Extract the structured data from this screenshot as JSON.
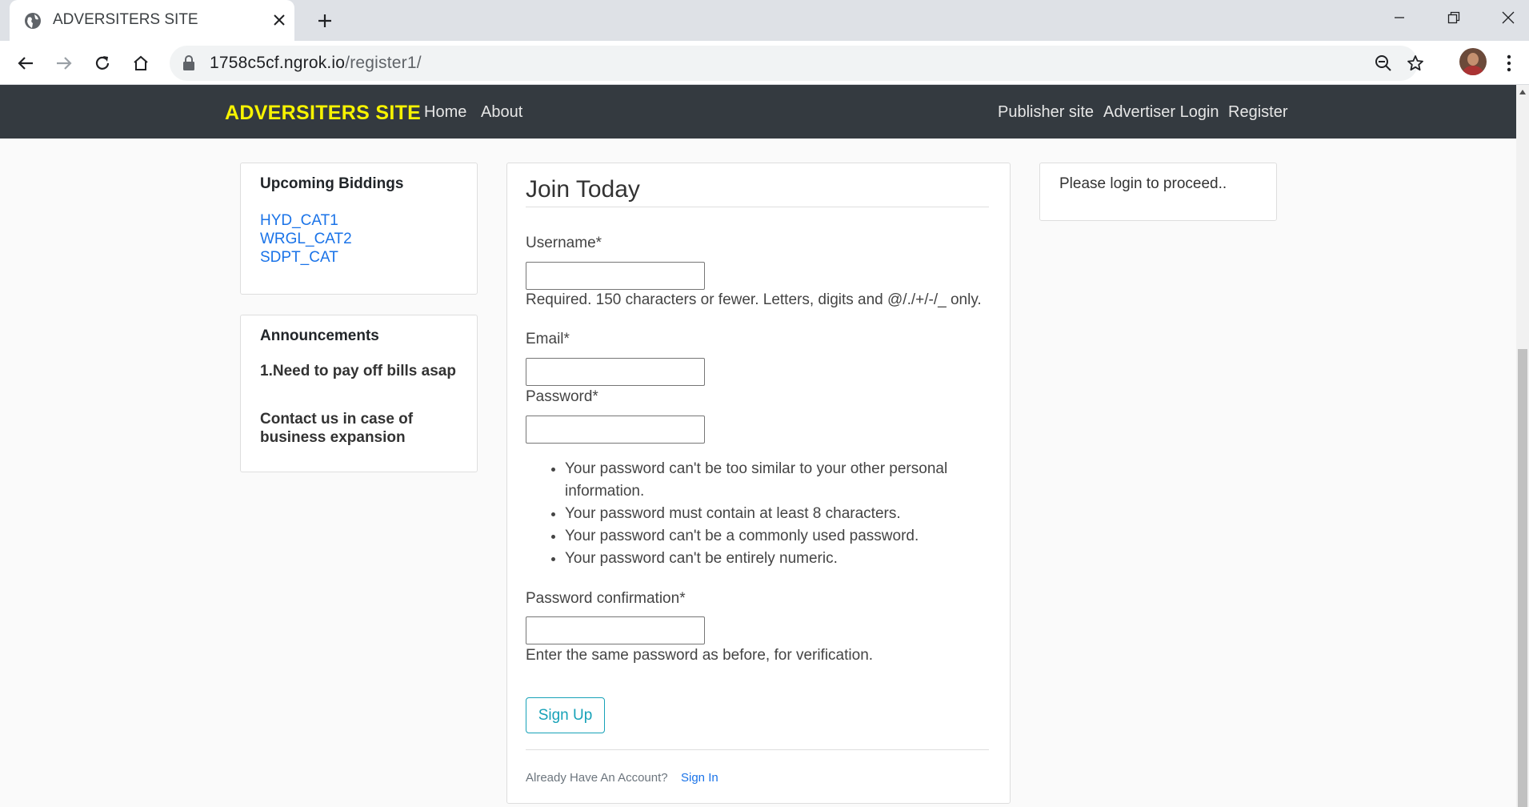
{
  "browser": {
    "tab_title": "ADVERSITERS SITE",
    "url_host": "1758c5cf.ngrok.io",
    "url_path": "/register1/",
    "icons": [
      "globe-icon",
      "close-icon",
      "plus-icon",
      "minimize-icon",
      "restore-icon",
      "window-close-icon",
      "back-icon",
      "forward-icon",
      "reload-icon",
      "home-icon",
      "lock-icon",
      "zoom-icon",
      "star-icon",
      "menu-dots-icon"
    ]
  },
  "navbar": {
    "brand": "ADVERSITERS SITE",
    "brand_color": "#f7f300",
    "home": "Home",
    "about": "About",
    "publisher": "Publisher site",
    "advertiser_login": "Advertiser Login",
    "register": "Register"
  },
  "sidebar": {
    "biddings_title": "Upcoming Biddings",
    "biddings": [
      "HYD_CAT1",
      "WRGL_CAT2",
      "SDPT_CAT"
    ],
    "announcements_title": "Announcements",
    "announcement_1": "1.Need to pay off bills asap",
    "announcement_2": "Contact us in case of business expansion"
  },
  "form": {
    "title": "Join Today",
    "username_label": "Username*",
    "username_help": "Required. 150 characters or fewer. Letters, digits and @/./+/-/_ only.",
    "email_label": "Email*",
    "password_label": "Password*",
    "password_rules": [
      "Your password can't be too similar to your other personal information.",
      "Your password must contain at least 8 characters.",
      "Your password can't be a commonly used password.",
      "Your password can't be entirely numeric."
    ],
    "confirm_label": "Password confirmation*",
    "confirm_help": "Enter the same password as before, for verification.",
    "submit": "Sign Up",
    "account_prompt": "Already Have An Account?",
    "sign_in": "Sign In"
  },
  "right_panel": {
    "message": "Please login to proceed.."
  }
}
